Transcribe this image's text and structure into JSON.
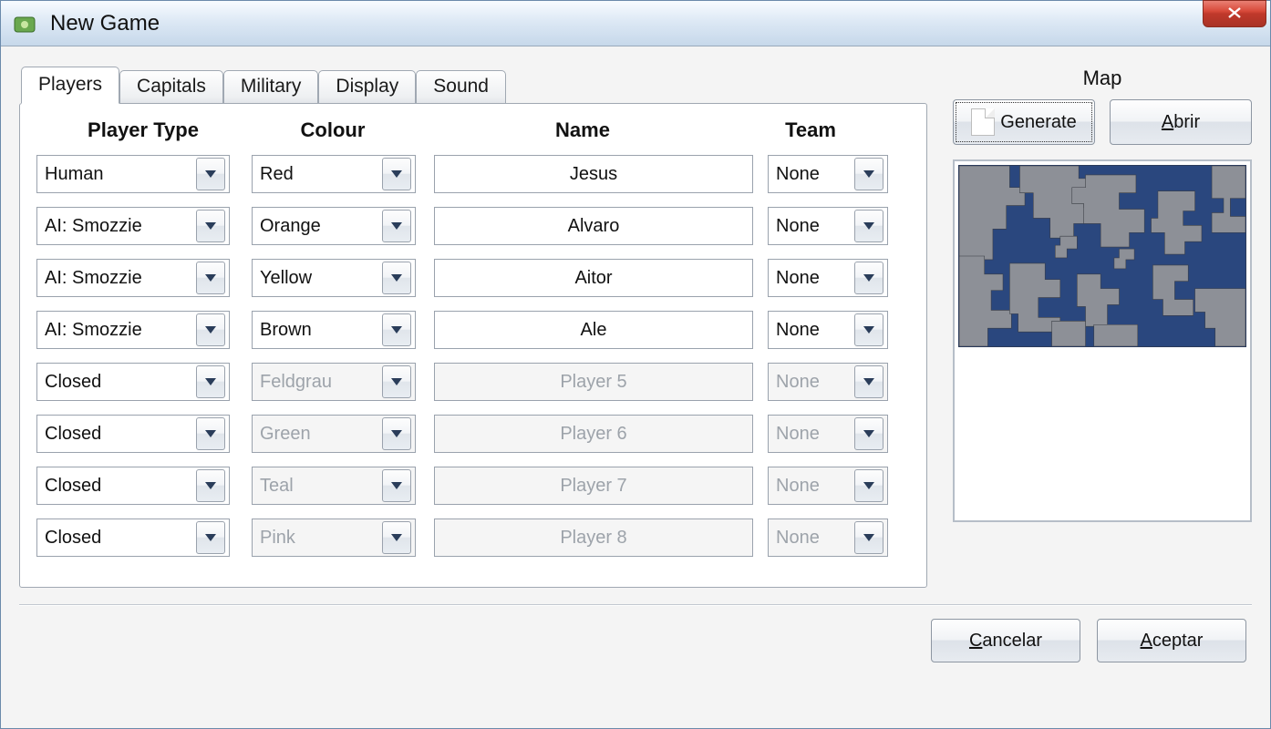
{
  "window": {
    "title": "New Game"
  },
  "tabs": [
    {
      "label": "Players",
      "active": true
    },
    {
      "label": "Capitals",
      "active": false
    },
    {
      "label": "Military",
      "active": false
    },
    {
      "label": "Display",
      "active": false
    },
    {
      "label": "Sound",
      "active": false
    }
  ],
  "columns": {
    "player_type": "Player Type",
    "colour": "Colour",
    "name": "Name",
    "team": "Team"
  },
  "players": [
    {
      "type": "Human",
      "colour": "Red",
      "name": "Jesus",
      "team": "None",
      "disabled": false
    },
    {
      "type": "AI: Smozzie",
      "colour": "Orange",
      "name": "Alvaro",
      "team": "None",
      "disabled": false
    },
    {
      "type": "AI: Smozzie",
      "colour": "Yellow",
      "name": "Aitor",
      "team": "None",
      "disabled": false
    },
    {
      "type": "AI: Smozzie",
      "colour": "Brown",
      "name": "Ale",
      "team": "None",
      "disabled": false
    },
    {
      "type": "Closed",
      "colour": "Feldgrau",
      "name": "Player 5",
      "team": "None",
      "disabled": true
    },
    {
      "type": "Closed",
      "colour": "Green",
      "name": "Player 6",
      "team": "None",
      "disabled": true
    },
    {
      "type": "Closed",
      "colour": "Teal",
      "name": "Player 7",
      "team": "None",
      "disabled": true
    },
    {
      "type": "Closed",
      "colour": "Pink",
      "name": "Player 8",
      "team": "None",
      "disabled": true
    }
  ],
  "map": {
    "label": "Map",
    "generate": "Generate",
    "open": "Abrir",
    "open_mnemonic": "A"
  },
  "buttons": {
    "cancel": "Cancelar",
    "cancel_mnemonic": "C",
    "accept": "Aceptar",
    "accept_mnemonic": "A"
  },
  "colors": {
    "titlebar_close": "#c0392b",
    "map_water": "#2a477e",
    "map_land": "#8d9097"
  }
}
